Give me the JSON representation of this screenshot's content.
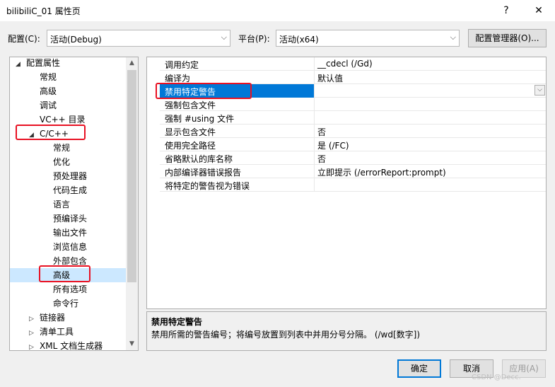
{
  "window": {
    "title": "bilibiliC_01 属性页",
    "help": "?",
    "close": "✕"
  },
  "config_bar": {
    "config_label": "配置(C):",
    "config_value": "活动(Debug)",
    "platform_label": "平台(P):",
    "platform_value": "活动(x64)",
    "config_manager_button": "配置管理器(O)..."
  },
  "tree": {
    "items": [
      {
        "label": "配置属性",
        "expand": "◢"
      },
      {
        "label": "常规"
      },
      {
        "label": "高级"
      },
      {
        "label": "调试"
      },
      {
        "label": "VC++ 目录"
      },
      {
        "label": "C/C++",
        "expand": "◢"
      },
      {
        "label": "常规"
      },
      {
        "label": "优化"
      },
      {
        "label": "预处理器"
      },
      {
        "label": "代码生成"
      },
      {
        "label": "语言"
      },
      {
        "label": "预编译头"
      },
      {
        "label": "输出文件"
      },
      {
        "label": "浏览信息"
      },
      {
        "label": "外部包含"
      },
      {
        "label": "高级",
        "selected": true
      },
      {
        "label": "所有选项"
      },
      {
        "label": "命令行"
      },
      {
        "label": "链接器",
        "expand": "▷"
      },
      {
        "label": "清单工具",
        "expand": "▷"
      },
      {
        "label": "XML 文档生成器",
        "expand": "▷"
      }
    ]
  },
  "properties": [
    {
      "name": "调用约定",
      "value": "__cdecl (/Gd)"
    },
    {
      "name": "编译为",
      "value": "默认值"
    },
    {
      "name": "禁用特定警告",
      "value": "",
      "selected": true
    },
    {
      "name": "强制包含文件",
      "value": ""
    },
    {
      "name": "强制 #using 文件",
      "value": ""
    },
    {
      "name": "显示包含文件",
      "value": "否"
    },
    {
      "name": "使用完全路径",
      "value": "是 (/FC)"
    },
    {
      "name": "省略默认的库名称",
      "value": "否"
    },
    {
      "name": "内部编译器错误报告",
      "value": "立即提示 (/errorReport:prompt)"
    },
    {
      "name": "将特定的警告视为错误",
      "value": ""
    }
  ],
  "description": {
    "title": "禁用特定警告",
    "text": "禁用所需的警告编号；将编号放置到列表中并用分号分隔。     (/wd[数字])"
  },
  "footer": {
    "ok": "确定",
    "cancel": "取消",
    "apply": "应用(A)"
  },
  "watermark": "CSDN @Decc.",
  "colors": {
    "selection": "#0078d7",
    "tree_selection": "#cce8ff",
    "highlight_box": "#e81123"
  }
}
